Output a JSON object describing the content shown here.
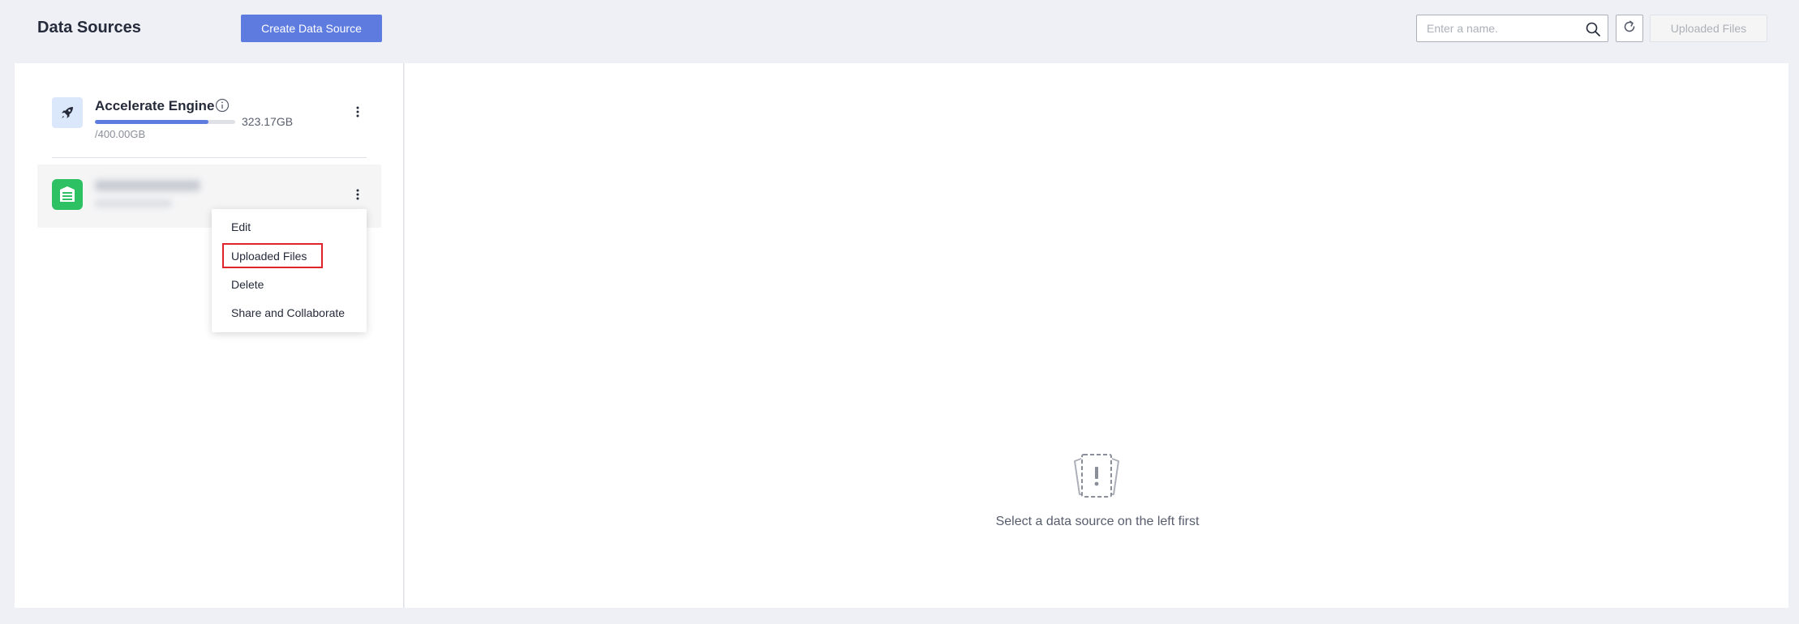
{
  "header": {
    "title": "Data Sources",
    "create_button_label": "Create Data Source",
    "search_placeholder": "Enter a name.",
    "uploaded_files_button_label": "Uploaded Files"
  },
  "sources": {
    "accelerate_engine": {
      "name": "Accelerate Engine",
      "used": "323.17GB",
      "total": "/400.00GB",
      "usage_fraction": 0.808
    },
    "selected_source": {
      "name_blurred": true
    }
  },
  "context_menu": {
    "items": [
      "Edit",
      "Uploaded Files",
      "Delete",
      "Share and Collaborate"
    ],
    "highlighted_item": "Uploaded Files"
  },
  "empty_state": {
    "message": "Select a data source on the left first"
  },
  "colors": {
    "primary": "#5e7ce0",
    "source_icon": "#2ec164",
    "highlight_border": "#e0242b",
    "page_background": "#eef0f5"
  },
  "icons": {
    "engine": "rocket-icon",
    "source": "database-icon",
    "search": "search-icon",
    "refresh": "refresh-icon",
    "info": "info-icon",
    "more": "more-vertical-icon",
    "empty": "empty-document-icon"
  }
}
